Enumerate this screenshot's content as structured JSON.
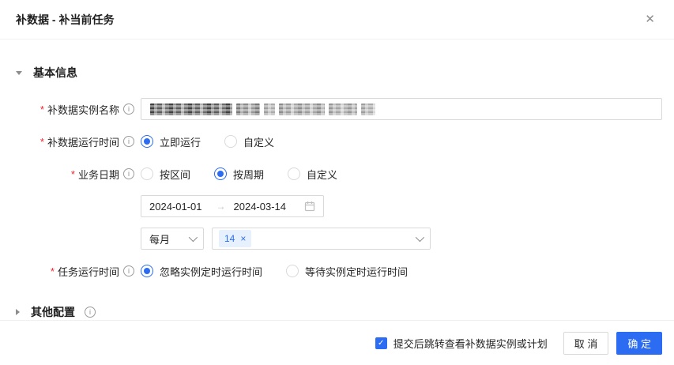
{
  "dialog": {
    "title": "补数据 - 补当前任务"
  },
  "icons": {
    "close": "✕",
    "info": "i",
    "tag_close": "×",
    "check": "✓"
  },
  "sections": {
    "basic": {
      "title": "基本信息"
    },
    "other": {
      "title": "其他配置"
    }
  },
  "form": {
    "instance_name": {
      "label": "补数据实例名称",
      "required": true,
      "value_masked": true
    },
    "run_time": {
      "label": "补数据运行时间",
      "options": [
        "立即运行",
        "自定义"
      ],
      "selected": "立即运行"
    },
    "business_date": {
      "label": "业务日期",
      "options": [
        "按区间",
        "按周期",
        "自定义"
      ],
      "selected": "按周期",
      "range_start": "2024-01-01",
      "range_end": "2024-03-14",
      "range_separator": "→",
      "cycle_unit": "每月",
      "cycle_tags": [
        "14"
      ]
    },
    "task_run_time": {
      "label": "任务运行时间",
      "options": [
        "忽略实例定时运行时间",
        "等待实例定时运行时间"
      ],
      "selected": "忽略实例定时运行时间"
    }
  },
  "footer": {
    "checkbox_label": "提交后跳转查看补数据实例或计划",
    "checkbox_checked": true,
    "cancel_label": "取 消",
    "confirm_label": "确 定"
  },
  "colors": {
    "primary": "#2b6cf2",
    "required_asterisk": "#f5222d",
    "tag_background": "#e7f1fe"
  }
}
